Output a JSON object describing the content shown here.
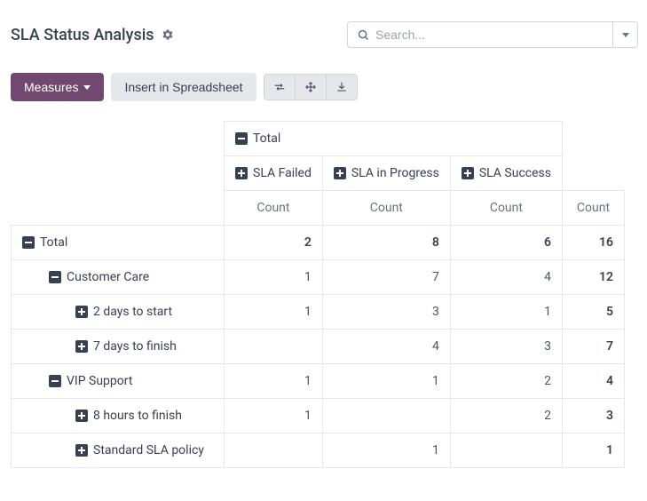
{
  "header": {
    "title": "SLA Status Analysis",
    "search_placeholder": "Search..."
  },
  "toolbar": {
    "measures_label": "Measures",
    "spreadsheet_label": "Insert in Spreadsheet"
  },
  "pivot": {
    "top_total": "Total",
    "col_headers": [
      "SLA Failed",
      "SLA in Progress",
      "SLA Success"
    ],
    "measure": "Count",
    "rows": [
      {
        "label": "Total",
        "indent": 0,
        "expand": "minus",
        "values": [
          2,
          8,
          6
        ],
        "total": 16
      },
      {
        "label": "Customer Care",
        "indent": 1,
        "expand": "minus",
        "values": [
          1,
          7,
          4
        ],
        "total": 12
      },
      {
        "label": "2 days to start",
        "indent": 2,
        "expand": "plus",
        "values": [
          1,
          3,
          1
        ],
        "total": 5
      },
      {
        "label": "7 days to finish",
        "indent": 2,
        "expand": "plus",
        "values": [
          "",
          4,
          3
        ],
        "total": 7
      },
      {
        "label": "VIP Support",
        "indent": 1,
        "expand": "minus",
        "values": [
          1,
          1,
          2
        ],
        "total": 4
      },
      {
        "label": "8 hours to finish",
        "indent": 2,
        "expand": "plus",
        "values": [
          1,
          "",
          2
        ],
        "total": 3
      },
      {
        "label": "Standard SLA policy",
        "indent": 2,
        "expand": "plus",
        "values": [
          "",
          1,
          ""
        ],
        "total": 1
      }
    ]
  }
}
